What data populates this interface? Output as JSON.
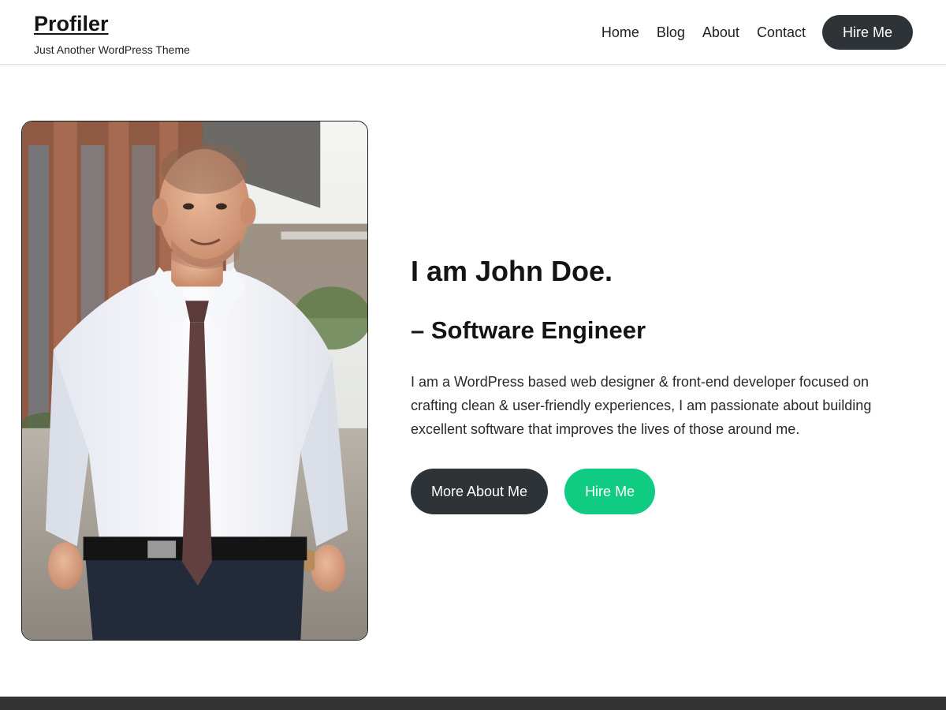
{
  "header": {
    "site_title": "Profiler",
    "tagline": "Just Another WordPress Theme",
    "nav": [
      {
        "label": "Home"
      },
      {
        "label": "Blog"
      },
      {
        "label": "About"
      },
      {
        "label": "Contact"
      }
    ],
    "cta_label": "Hire Me"
  },
  "hero": {
    "photo_icon": "profile-photo",
    "title": "I am John Doe.",
    "subtitle": "– Software Engineer",
    "description": "I am a WordPress based web designer & front-end developer focused on crafting clean & user-friendly experiences, I am passionate about building excellent software that improves the lives of those around me.",
    "primary_button": "More About Me",
    "secondary_button": "Hire Me"
  },
  "colors": {
    "dark_button": "#2e3338",
    "accent_green": "#0fcc82",
    "footer": "#333333"
  }
}
